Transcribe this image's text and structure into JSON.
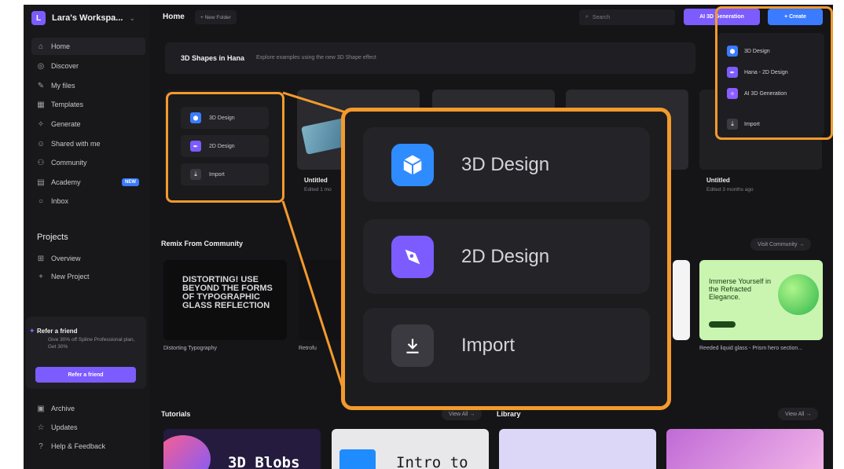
{
  "workspace": {
    "avatar_letter": "L",
    "name": "Lara's Workspa..."
  },
  "sidebar": {
    "items": [
      {
        "label": "Home",
        "icon": "home-icon"
      },
      {
        "label": "Discover",
        "icon": "compass-icon"
      },
      {
        "label": "My files",
        "icon": "pen-icon"
      },
      {
        "label": "Templates",
        "icon": "templates-icon"
      },
      {
        "label": "Generate",
        "icon": "sparkle-icon"
      },
      {
        "label": "Shared with me",
        "icon": "shared-icon"
      },
      {
        "label": "Community",
        "icon": "community-icon"
      },
      {
        "label": "Academy",
        "icon": "book-icon",
        "badge": "NEW"
      },
      {
        "label": "Inbox",
        "icon": "inbox-icon"
      }
    ],
    "projects_label": "Projects",
    "project_items": [
      {
        "label": "Overview",
        "icon": "grid-icon"
      },
      {
        "label": "New Project",
        "icon": "plus-icon"
      }
    ],
    "refer": {
      "title": "Refer a friend",
      "desc": "Give 30% off Spline Professional plan, Get 30%",
      "button": "Refer a friend"
    },
    "bottom_items": [
      {
        "label": "Archive",
        "icon": "archive-icon"
      },
      {
        "label": "Updates",
        "icon": "star-icon"
      },
      {
        "label": "Help & Feedback",
        "icon": "help-icon"
      }
    ]
  },
  "topbar": {
    "title": "Home",
    "new_folder": "+ New Folder",
    "search_placeholder": "Search",
    "ai_button": "AI 3D Generation",
    "create_button": "+ Create"
  },
  "banner": {
    "title": "3D Shapes in Hana",
    "subtitle": "Explore examples using the new 3D Shape effect"
  },
  "small_menu": {
    "items": [
      "3D Design",
      "2D Design",
      "Import"
    ]
  },
  "recent": [
    {
      "title": "Untitled",
      "meta": "Edited 1 mo"
    },
    {
      "title": "Untitled",
      "meta": "Edited 3 months ago"
    }
  ],
  "remix": {
    "title": "Remix From Community",
    "visit": "Visit Community →",
    "poster_text": "DISTORTING! USE BEYOND THE FORMS OF TYPOGRAPHIC GLASS REFLECTION",
    "cards": [
      "Distorting Typography",
      "Retrofu",
      "Reeded liquid glass - Prism hero section..."
    ],
    "promo_text": "Immerse Yourself in the Refracted Elegance."
  },
  "tutorials": {
    "title": "Tutorials",
    "view_all": "View All →",
    "library": "Library",
    "library_view_all": "View All →",
    "cards": [
      "3D Blobs",
      "Intro to"
    ]
  },
  "dropdown": {
    "items": [
      "3D Design",
      "Hana - 2D Design",
      "AI 3D Generation",
      "Import"
    ]
  },
  "zoom": {
    "items": [
      "3D Design",
      "2D Design",
      "Import"
    ]
  },
  "colors": {
    "accent_purple": "#7c5cff",
    "accent_blue": "#3b7bff",
    "highlight_orange": "#f39a2c"
  }
}
